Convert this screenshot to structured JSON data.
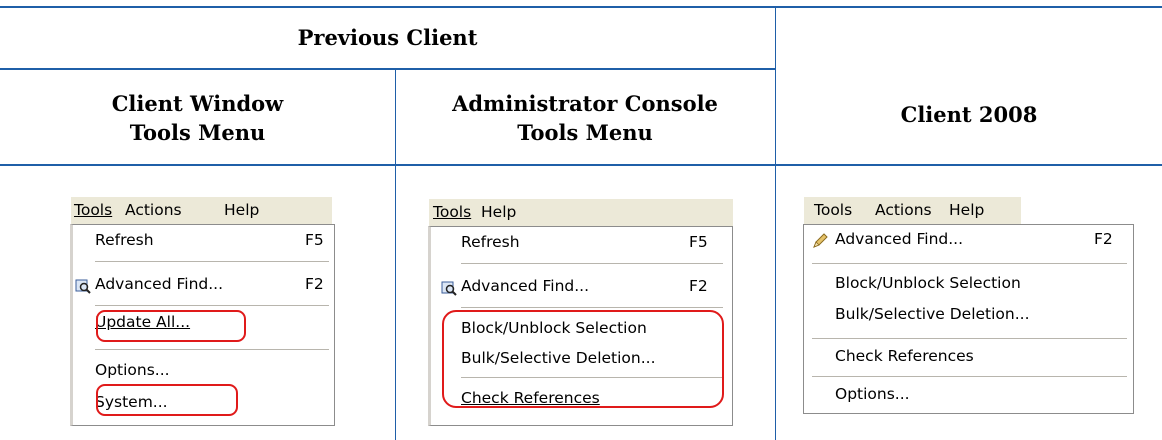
{
  "headers": {
    "previous_client": "Previous Client",
    "client_window": "Client Window",
    "client_window_sub": "Tools Menu",
    "admin_console": "Administrator Console",
    "admin_console_sub": "Tools Menu",
    "client_2008": "Client 2008"
  },
  "menu1": {
    "bar": [
      "Tools",
      "Actions",
      "Help"
    ],
    "items": {
      "refresh": "Refresh",
      "refresh_key": "F5",
      "advanced_find": "Advanced Find...",
      "advanced_find_key": "F2",
      "update_all": "Update All...",
      "options": "Options...",
      "system": "System..."
    }
  },
  "menu2": {
    "bar": [
      "Tools",
      "Help"
    ],
    "items": {
      "refresh": "Refresh",
      "refresh_key": "F5",
      "advanced_find": "Advanced Find...",
      "advanced_find_key": "F2",
      "block_unblock": "Block/Unblock Selection",
      "bulk_delete": "Bulk/Selective Deletion...",
      "check_refs": "Check References"
    }
  },
  "menu3": {
    "bar": [
      "Tools",
      "Actions",
      "Help"
    ],
    "items": {
      "advanced_find": "Advanced Find...",
      "advanced_find_key": "F2",
      "block_unblock": "Block/Unblock Selection",
      "bulk_delete": "Bulk/Selective Deletion...",
      "check_refs": "Check References",
      "options": "Options..."
    }
  },
  "colors": {
    "rule": "#1f5fa8",
    "highlight": "#e01a1a",
    "menubar": "#ece9d8"
  },
  "icons": {
    "find": "advanced-find-icon",
    "find_2008": "pencil-find-icon"
  }
}
